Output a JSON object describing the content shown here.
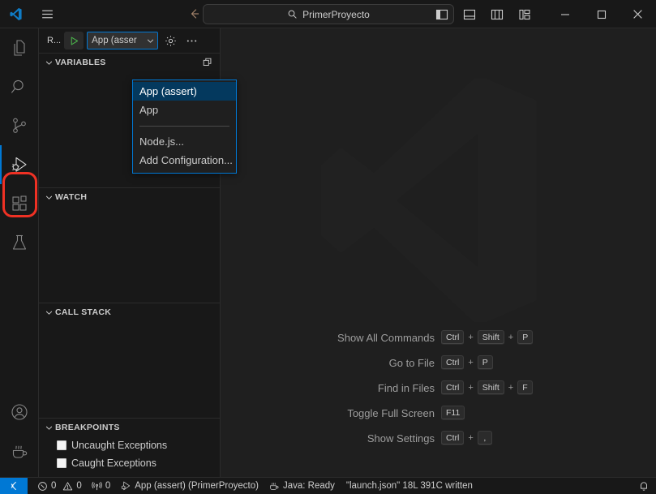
{
  "window": {
    "titlebar": {
      "logo_icon": "vscode-logo-icon",
      "menu_icon": "hamburger-menu-icon",
      "back_icon": "arrow-back-icon",
      "forward_icon": "arrow-forward-icon",
      "search": {
        "icon": "search-icon",
        "value": "PrimerProyecto"
      },
      "layout_icons": [
        "toggle-primary-sidebar-icon",
        "toggle-panel-icon",
        "toggle-secondary-sidebar-icon",
        "customize-layout-icon"
      ],
      "minimize_icon": "minimize-icon",
      "maximize_icon": "maximize-icon",
      "close_icon": "close-icon"
    }
  },
  "activitybar": {
    "items": [
      {
        "name": "explorer",
        "icon": "files-icon",
        "active": false
      },
      {
        "name": "search",
        "icon": "search-icon",
        "active": false
      },
      {
        "name": "source-control",
        "icon": "source-control-icon",
        "active": false
      },
      {
        "name": "run-and-debug",
        "icon": "run-and-debug-icon",
        "active": true
      },
      {
        "name": "extensions",
        "icon": "extensions-icon",
        "active": false
      },
      {
        "name": "testing",
        "icon": "beaker-icon",
        "active": false
      }
    ],
    "bottom_items": [
      {
        "name": "accounts",
        "icon": "account-icon"
      },
      {
        "name": "java-projects",
        "icon": "coffee-cup-icon"
      }
    ],
    "highlight_color": "#ef3124"
  },
  "sidebar": {
    "toolbar": {
      "title": "R...",
      "run_icon": "start-debugging-play-icon",
      "config_value": "App (asser",
      "config_chevron_icon": "chevron-down-icon",
      "gear_icon": "open-launch-json-gear-icon",
      "more_icon": "more-actions-icon"
    },
    "dropdown": {
      "items": [
        {
          "label": "App (assert)",
          "selected": true
        },
        {
          "label": "App",
          "selected": false
        },
        {
          "separator": true
        },
        {
          "label": "Node.js...",
          "selected": false
        },
        {
          "label": "Add Configuration...",
          "selected": false
        }
      ]
    },
    "sections": [
      {
        "name": "variables",
        "title": "VARIABLES",
        "chevron_icon": "chevron-down-icon",
        "action_icon": "copy-icon"
      },
      {
        "name": "watch",
        "title": "WATCH",
        "chevron_icon": "chevron-down-icon"
      },
      {
        "name": "call-stack",
        "title": "CALL STACK",
        "chevron_icon": "chevron-down-icon"
      },
      {
        "name": "breakpoints",
        "title": "BREAKPOINTS",
        "chevron_icon": "chevron-down-icon",
        "rows": [
          {
            "label": "Uncaught Exceptions",
            "checked": false
          },
          {
            "label": "Caught Exceptions",
            "checked": false
          }
        ]
      }
    ]
  },
  "editor": {
    "watermark_icon": "vscode-watermark-logo",
    "shortcuts": [
      {
        "label": "Show All Commands",
        "keys": [
          "Ctrl",
          "+",
          "Shift",
          "+",
          "P"
        ]
      },
      {
        "label": "Go to File",
        "keys": [
          "Ctrl",
          "+",
          "P"
        ]
      },
      {
        "label": "Find in Files",
        "keys": [
          "Ctrl",
          "+",
          "Shift",
          "+",
          "F"
        ]
      },
      {
        "label": "Toggle Full Screen",
        "keys": [
          "F11"
        ]
      },
      {
        "label": "Show Settings",
        "keys": [
          "Ctrl",
          "+",
          ","
        ]
      }
    ]
  },
  "statusbar": {
    "remote_icon": "remote-window-icon",
    "problems": {
      "error_icon": "error-circle-icon",
      "error_count": "0",
      "warning_icon": "warning-triangle-icon",
      "warning_count": "0"
    },
    "ports": {
      "icon": "radio-tower-icon",
      "count": "0"
    },
    "debug_config": {
      "icon": "run-and-debug-icon",
      "label": "App (assert) (PrimerProyecto)"
    },
    "java": {
      "icon": "coffee-cup-icon",
      "label": "Java: Ready"
    },
    "message": "\"launch.json\" 18L 391C written",
    "bell_icon": "notifications-bell-icon"
  }
}
